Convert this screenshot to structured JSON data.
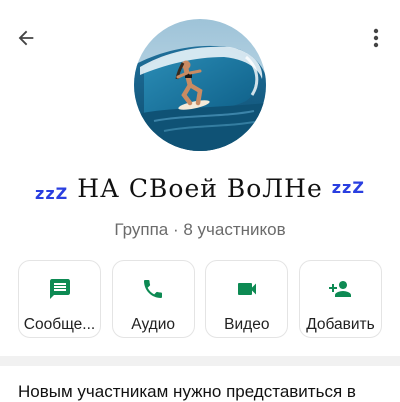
{
  "header": {
    "back_icon": "arrow-left-icon",
    "menu_icon": "more-vertical-icon"
  },
  "group": {
    "name_deco_left": "zzZ",
    "name": "НА СВоей ВоЛНе",
    "name_deco_right": "zzZ",
    "subtitle": "Группа · 8 участников"
  },
  "actions": [
    {
      "label": "Сообще...",
      "icon": "message-icon"
    },
    {
      "label": "Аудио",
      "icon": "phone-icon"
    },
    {
      "label": "Видео",
      "icon": "video-icon"
    },
    {
      "label": "Добавить",
      "icon": "add-person-icon"
    }
  ],
  "description": "Новым участникам нужно представиться в",
  "colors": {
    "accent": "#0d8a53",
    "name_deco": "#2a3fe0"
  }
}
